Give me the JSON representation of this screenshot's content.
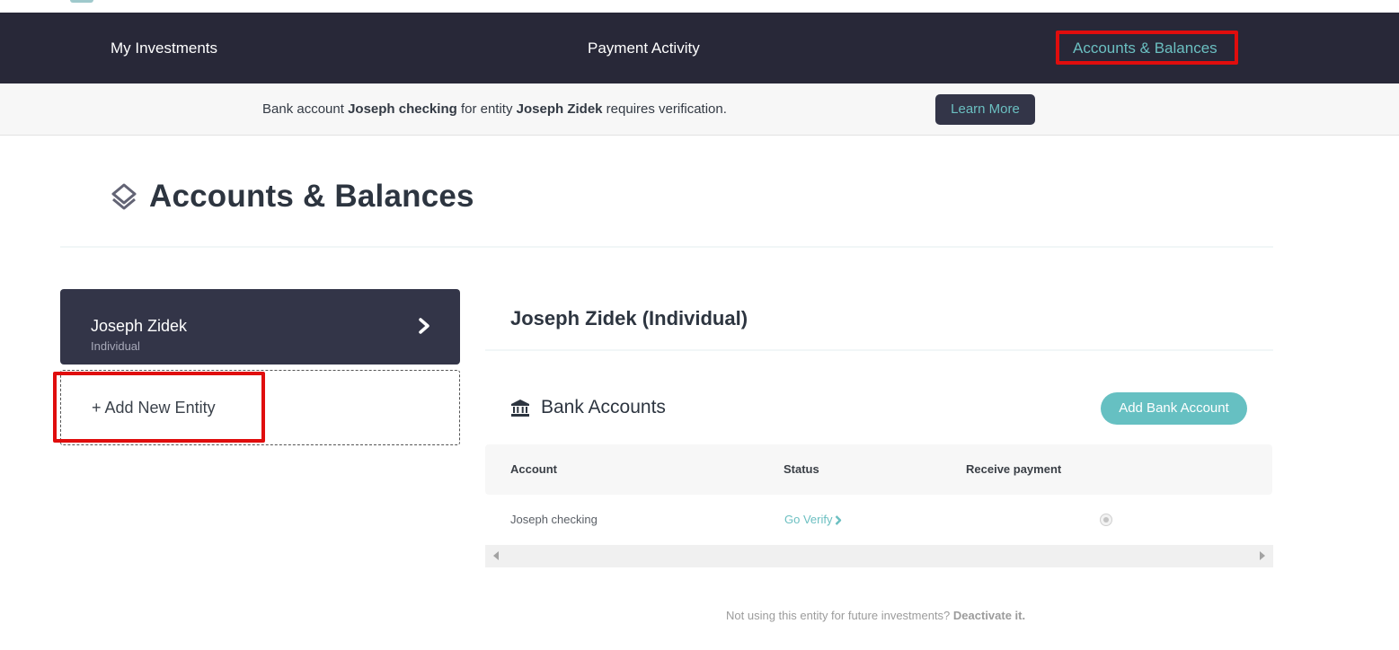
{
  "nav": {
    "items": [
      {
        "label": "My Investments",
        "active": false
      },
      {
        "label": "Payment Activity",
        "active": false
      },
      {
        "label": "Accounts & Balances",
        "active": true
      }
    ]
  },
  "banner": {
    "prefix": "Bank account ",
    "account": "Joseph checking",
    "middle": " for entity ",
    "entity": "Joseph Zidek",
    "suffix": " requires verification.",
    "button_label": "Learn More"
  },
  "page": {
    "title": "Accounts & Balances",
    "icon": "layers-icon"
  },
  "entities": {
    "selected": {
      "name": "Joseph Zidek",
      "type": "Individual"
    },
    "add_label": "+ Add New Entity"
  },
  "detail": {
    "title": "Joseph Zidek (Individual)",
    "bank_section": {
      "title": "Bank Accounts",
      "icon": "bank-icon",
      "add_button": "Add Bank Account",
      "columns": [
        "Account",
        "Status",
        "Receive payment"
      ],
      "rows": [
        {
          "account": "Joseph checking",
          "status": "Go Verify",
          "receive_payment": "disabled"
        }
      ]
    },
    "deactivate": {
      "prompt": "Not using this entity for future investments? ",
      "link": "Deactivate it."
    }
  },
  "colors": {
    "nav_bg": "#282838",
    "accent": "#6bbfc1",
    "card_bg": "#333548",
    "highlight": "#e00d0d"
  }
}
